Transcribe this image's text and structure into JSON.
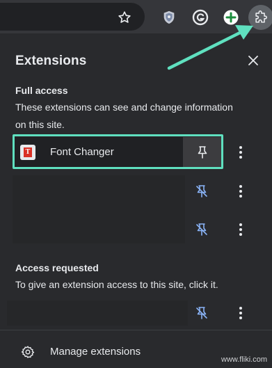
{
  "toolbar": {
    "icons": [
      "star-icon",
      "shield-extension-icon",
      "grammarly-icon",
      "plus-extension-icon",
      "puzzle-icon"
    ]
  },
  "panel": {
    "title": "Extensions",
    "full_access": {
      "title": "Full access",
      "desc_line1": "These extensions can see and change information",
      "desc_line2": "on this site.",
      "items": [
        {
          "name": "Font Changer",
          "pinned": true
        },
        {
          "name": "",
          "pinned": false
        },
        {
          "name": "",
          "pinned": false
        }
      ]
    },
    "access_requested": {
      "title": "Access requested",
      "desc": "To give an extension access to this site, click it.",
      "items": [
        {
          "name": "",
          "pinned": false
        }
      ]
    },
    "manage_label": "Manage extensions"
  },
  "watermark": "www.fliki.com",
  "colors": {
    "highlight": "#5fe0bf",
    "unpin_blue": "#8ab4f8",
    "panel_bg": "#292a2d",
    "text": "#e8eaed"
  }
}
